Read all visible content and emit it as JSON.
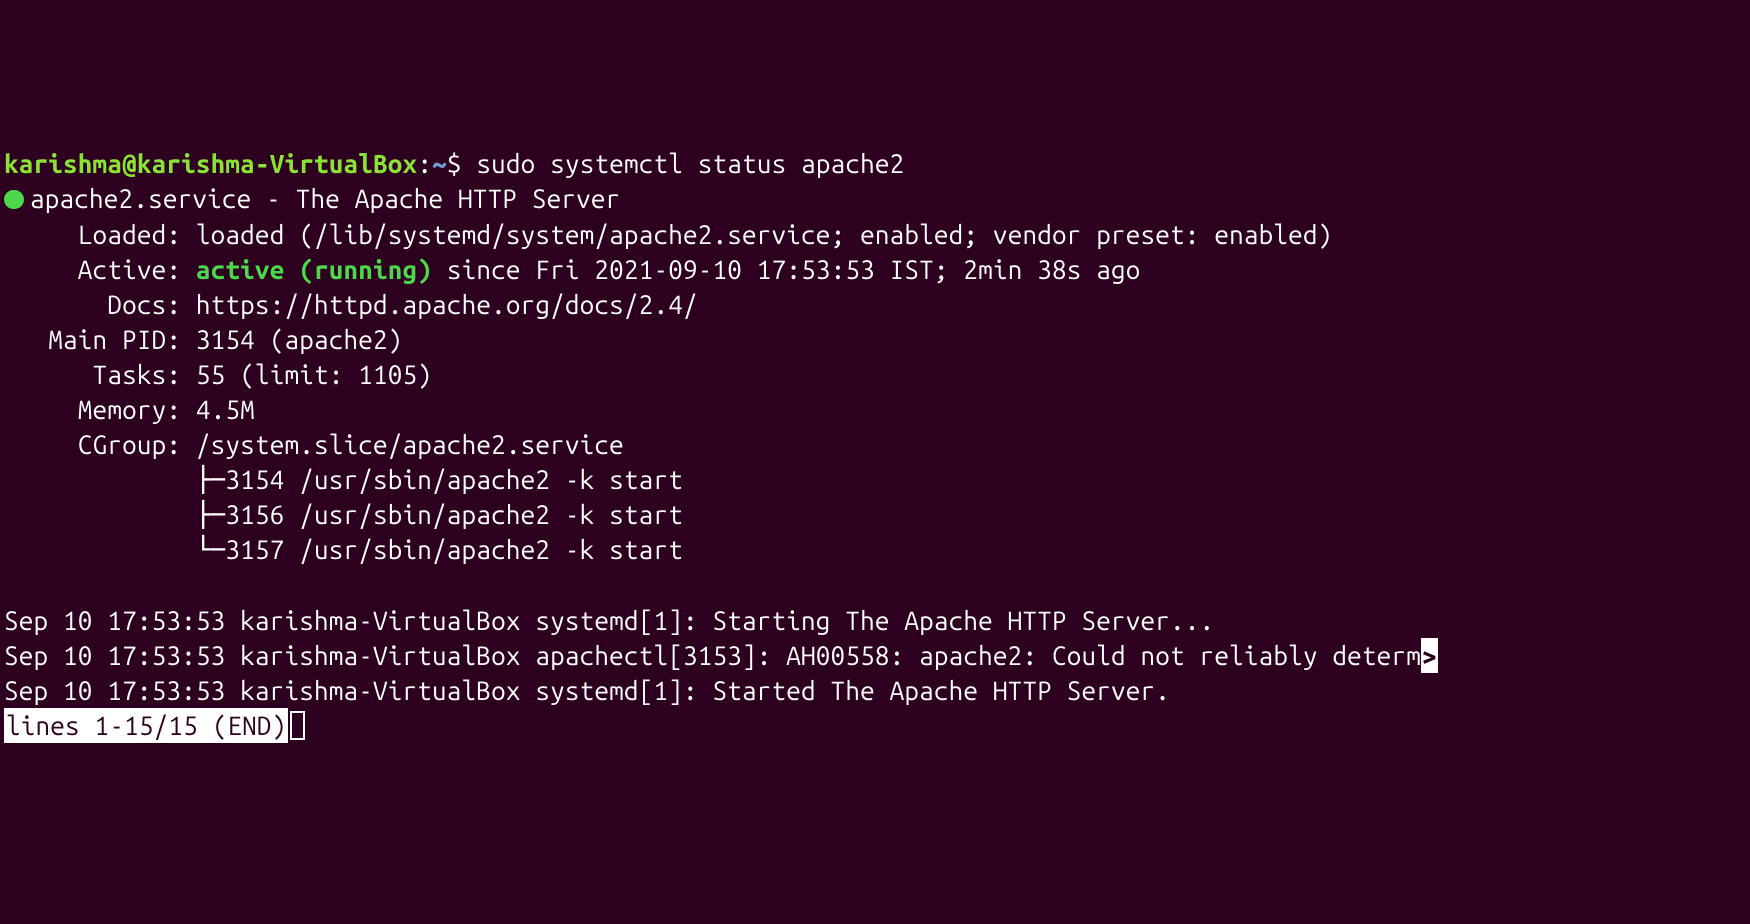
{
  "prompt": {
    "user": "karishma",
    "at": "@",
    "host": "karishma-VirtualBox",
    "colon": ":",
    "path": "~",
    "symbol": "$",
    "command": "sudo systemctl status apache2"
  },
  "service": {
    "name": "apache2.service",
    "dash": " - ",
    "desc": "The Apache HTTP Server"
  },
  "loaded": {
    "label": "     Loaded: ",
    "value": "loaded (/lib/systemd/system/apache2.service; enabled; vendor preset: enabled)"
  },
  "active": {
    "label": "     Active: ",
    "state": "active (running)",
    "since": " since Fri 2021-09-10 17:53:53 IST; 2min 38s ago"
  },
  "docs": {
    "label": "       Docs: ",
    "value": "https://httpd.apache.org/docs/2.4/"
  },
  "mainpid": {
    "label": "   Main PID: ",
    "value": "3154 (apache2)"
  },
  "tasks": {
    "label": "      Tasks: ",
    "value": "55 (limit: 1105)"
  },
  "memory": {
    "label": "     Memory: ",
    "value": "4.5M"
  },
  "cgroup": {
    "label": "     CGroup: ",
    "value": "/system.slice/apache2.service",
    "p1": "             ├─3154 /usr/sbin/apache2 -k start",
    "p2": "             ├─3156 /usr/sbin/apache2 -k start",
    "p3": "             └─3157 /usr/sbin/apache2 -k start"
  },
  "logs": {
    "l1": "Sep 10 17:53:53 karishma-VirtualBox systemd[1]: Starting The Apache HTTP Server...",
    "l2a": "Sep 10 17:53:53 karishma-VirtualBox apachectl[3153]: AH00558: apache2: Could not reliably determ",
    "l2trunc": ">",
    "l3": "Sep 10 17:53:53 karishma-VirtualBox systemd[1]: Started The Apache HTTP Server."
  },
  "pager": "lines 1-15/15 (END)"
}
